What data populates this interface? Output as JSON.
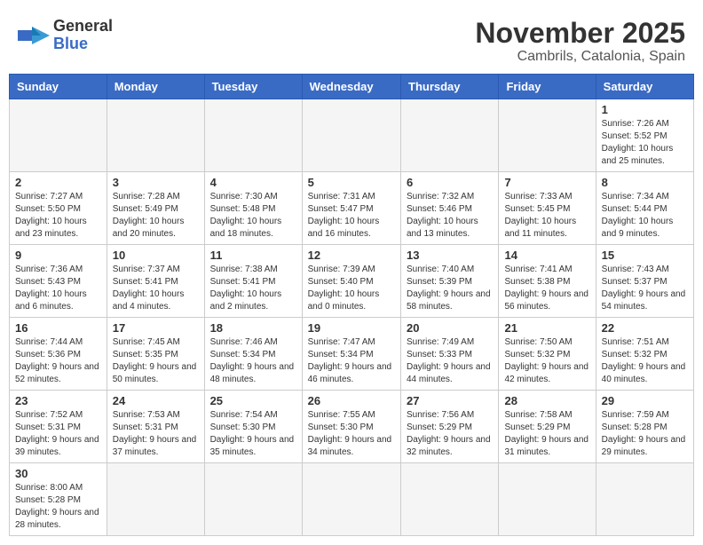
{
  "header": {
    "logo_general": "General",
    "logo_blue": "Blue",
    "month_title": "November 2025",
    "location": "Cambrils, Catalonia, Spain"
  },
  "weekdays": [
    "Sunday",
    "Monday",
    "Tuesday",
    "Wednesday",
    "Thursday",
    "Friday",
    "Saturday"
  ],
  "weeks": [
    [
      {
        "day": "",
        "info": ""
      },
      {
        "day": "",
        "info": ""
      },
      {
        "day": "",
        "info": ""
      },
      {
        "day": "",
        "info": ""
      },
      {
        "day": "",
        "info": ""
      },
      {
        "day": "",
        "info": ""
      },
      {
        "day": "1",
        "info": "Sunrise: 7:26 AM\nSunset: 5:52 PM\nDaylight: 10 hours and 25 minutes."
      }
    ],
    [
      {
        "day": "2",
        "info": "Sunrise: 7:27 AM\nSunset: 5:50 PM\nDaylight: 10 hours and 23 minutes."
      },
      {
        "day": "3",
        "info": "Sunrise: 7:28 AM\nSunset: 5:49 PM\nDaylight: 10 hours and 20 minutes."
      },
      {
        "day": "4",
        "info": "Sunrise: 7:30 AM\nSunset: 5:48 PM\nDaylight: 10 hours and 18 minutes."
      },
      {
        "day": "5",
        "info": "Sunrise: 7:31 AM\nSunset: 5:47 PM\nDaylight: 10 hours and 16 minutes."
      },
      {
        "day": "6",
        "info": "Sunrise: 7:32 AM\nSunset: 5:46 PM\nDaylight: 10 hours and 13 minutes."
      },
      {
        "day": "7",
        "info": "Sunrise: 7:33 AM\nSunset: 5:45 PM\nDaylight: 10 hours and 11 minutes."
      },
      {
        "day": "8",
        "info": "Sunrise: 7:34 AM\nSunset: 5:44 PM\nDaylight: 10 hours and 9 minutes."
      }
    ],
    [
      {
        "day": "9",
        "info": "Sunrise: 7:36 AM\nSunset: 5:43 PM\nDaylight: 10 hours and 6 minutes."
      },
      {
        "day": "10",
        "info": "Sunrise: 7:37 AM\nSunset: 5:41 PM\nDaylight: 10 hours and 4 minutes."
      },
      {
        "day": "11",
        "info": "Sunrise: 7:38 AM\nSunset: 5:41 PM\nDaylight: 10 hours and 2 minutes."
      },
      {
        "day": "12",
        "info": "Sunrise: 7:39 AM\nSunset: 5:40 PM\nDaylight: 10 hours and 0 minutes."
      },
      {
        "day": "13",
        "info": "Sunrise: 7:40 AM\nSunset: 5:39 PM\nDaylight: 9 hours and 58 minutes."
      },
      {
        "day": "14",
        "info": "Sunrise: 7:41 AM\nSunset: 5:38 PM\nDaylight: 9 hours and 56 minutes."
      },
      {
        "day": "15",
        "info": "Sunrise: 7:43 AM\nSunset: 5:37 PM\nDaylight: 9 hours and 54 minutes."
      }
    ],
    [
      {
        "day": "16",
        "info": "Sunrise: 7:44 AM\nSunset: 5:36 PM\nDaylight: 9 hours and 52 minutes."
      },
      {
        "day": "17",
        "info": "Sunrise: 7:45 AM\nSunset: 5:35 PM\nDaylight: 9 hours and 50 minutes."
      },
      {
        "day": "18",
        "info": "Sunrise: 7:46 AM\nSunset: 5:34 PM\nDaylight: 9 hours and 48 minutes."
      },
      {
        "day": "19",
        "info": "Sunrise: 7:47 AM\nSunset: 5:34 PM\nDaylight: 9 hours and 46 minutes."
      },
      {
        "day": "20",
        "info": "Sunrise: 7:49 AM\nSunset: 5:33 PM\nDaylight: 9 hours and 44 minutes."
      },
      {
        "day": "21",
        "info": "Sunrise: 7:50 AM\nSunset: 5:32 PM\nDaylight: 9 hours and 42 minutes."
      },
      {
        "day": "22",
        "info": "Sunrise: 7:51 AM\nSunset: 5:32 PM\nDaylight: 9 hours and 40 minutes."
      }
    ],
    [
      {
        "day": "23",
        "info": "Sunrise: 7:52 AM\nSunset: 5:31 PM\nDaylight: 9 hours and 39 minutes."
      },
      {
        "day": "24",
        "info": "Sunrise: 7:53 AM\nSunset: 5:31 PM\nDaylight: 9 hours and 37 minutes."
      },
      {
        "day": "25",
        "info": "Sunrise: 7:54 AM\nSunset: 5:30 PM\nDaylight: 9 hours and 35 minutes."
      },
      {
        "day": "26",
        "info": "Sunrise: 7:55 AM\nSunset: 5:30 PM\nDaylight: 9 hours and 34 minutes."
      },
      {
        "day": "27",
        "info": "Sunrise: 7:56 AM\nSunset: 5:29 PM\nDaylight: 9 hours and 32 minutes."
      },
      {
        "day": "28",
        "info": "Sunrise: 7:58 AM\nSunset: 5:29 PM\nDaylight: 9 hours and 31 minutes."
      },
      {
        "day": "29",
        "info": "Sunrise: 7:59 AM\nSunset: 5:28 PM\nDaylight: 9 hours and 29 minutes."
      }
    ],
    [
      {
        "day": "30",
        "info": "Sunrise: 8:00 AM\nSunset: 5:28 PM\nDaylight: 9 hours and 28 minutes."
      },
      {
        "day": "",
        "info": ""
      },
      {
        "day": "",
        "info": ""
      },
      {
        "day": "",
        "info": ""
      },
      {
        "day": "",
        "info": ""
      },
      {
        "day": "",
        "info": ""
      },
      {
        "day": "",
        "info": ""
      }
    ]
  ]
}
